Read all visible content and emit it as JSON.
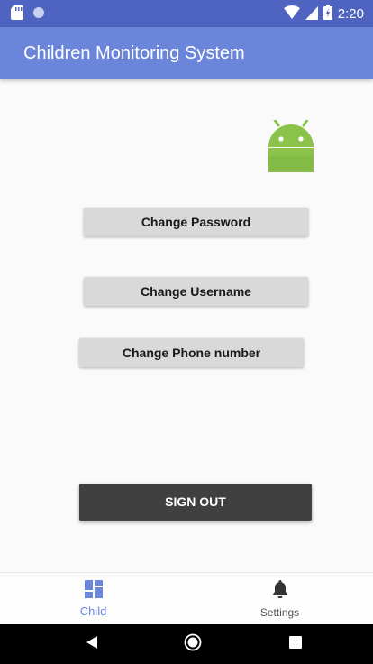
{
  "status_bar": {
    "time": "2:20",
    "icons": [
      "sd-card-icon",
      "circle-icon",
      "wifi-icon",
      "cell-signal-icon",
      "battery-icon"
    ]
  },
  "app_bar": {
    "title": "Children Monitoring System"
  },
  "main": {
    "logo": "android-icon",
    "buttons": {
      "change_password": "Change Password",
      "change_username": "Change Username",
      "change_phone": "Change Phone number",
      "sign_out": "SIGN OUT"
    }
  },
  "bottom_nav": {
    "items": [
      {
        "label": "Child",
        "icon": "dashboard-icon",
        "active": true
      },
      {
        "label": "Settings",
        "icon": "bell-icon",
        "active": false
      }
    ]
  },
  "colors": {
    "status_bar": "#4f63c0",
    "app_bar": "#6b85db",
    "accent": "#6b85db",
    "android_green": "#8bc34a",
    "sign_out_bg": "#404040",
    "button_bg": "#d9d9d9"
  }
}
